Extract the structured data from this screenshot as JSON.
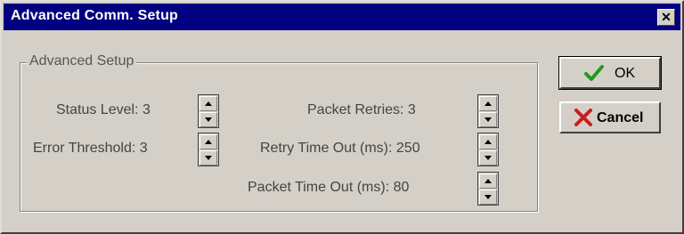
{
  "window": {
    "title": "Advanced Comm. Setup",
    "close_glyph": "✕"
  },
  "group": {
    "label": "Advanced Setup"
  },
  "fields": {
    "status_level": "Status Level: 3",
    "error_threshold": "Error Threshold: 3",
    "packet_retries": "Packet Retries: 3",
    "retry_time_out": "Retry Time Out (ms): 250",
    "packet_time_out": "Packet Time Out (ms): 80"
  },
  "buttons": {
    "ok_label": "OK",
    "cancel_label": "Cancel"
  },
  "icons": {
    "ok": "check-icon",
    "cancel": "x-icon"
  },
  "colors": {
    "titlebar": "#000080",
    "dialog_face": "#d4d0c8",
    "ok_check": "#1f9b1f",
    "cancel_x": "#c81e1e"
  }
}
